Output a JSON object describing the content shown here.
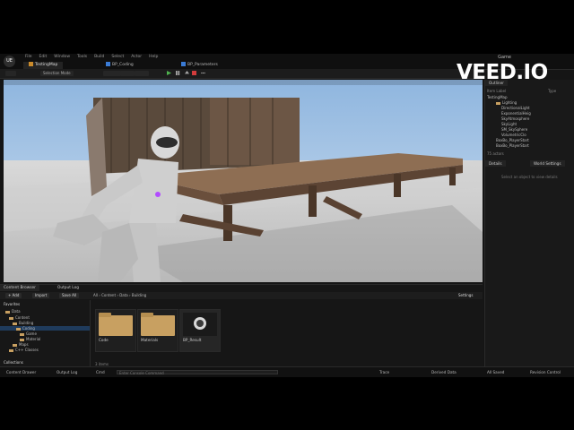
{
  "window": {
    "logo": "UE",
    "game_label": "Game",
    "menu": [
      "File",
      "Edit",
      "Window",
      "Tools",
      "Build",
      "Select",
      "Actor",
      "Help"
    ],
    "tabs": [
      {
        "label": "TestingMap"
      },
      {
        "label": "BP_Coding"
      },
      {
        "label": "BP_Parameters"
      }
    ]
  },
  "toolbar": {
    "mode": "Selection Mode"
  },
  "watermark": "VEED.IO",
  "outliner": {
    "tab": "Outliner",
    "header_label": "Item Label",
    "header_type": "Type",
    "rows": [
      {
        "label": "TestingMap",
        "type": "World"
      },
      {
        "label": "Lighting",
        "type": "Folder"
      },
      {
        "label": "DirectionalLight",
        "type": "DirectionalL"
      },
      {
        "label": "ExponentialHeig",
        "type": "ExponentialH"
      },
      {
        "label": "SkyAtmosphere",
        "type": "SkyAtmosph"
      },
      {
        "label": "SkyLight",
        "type": "SkyLight"
      },
      {
        "label": "SM_SkySphere",
        "type": "StaticMesh"
      },
      {
        "label": "VolumetricClo",
        "type": "VolumetricC"
      },
      {
        "label": "BoxBo_PlayerStart",
        "type": "Object Ref"
      },
      {
        "label": "BoxBo_PlayerStart",
        "type": "Object Ref"
      }
    ],
    "count": "75 actors"
  },
  "details": {
    "tab_details": "Details",
    "tab_world": "World Settings",
    "empty_text": "Select an object to view details"
  },
  "bottom": {
    "tab_content": "Content Browser",
    "tab_output": "Output Log",
    "add_label": "+ Add",
    "import_label": "Import",
    "save_all_label": "Save All",
    "breadcrumb": [
      "All",
      "Content",
      "Data",
      "Building"
    ],
    "settings_label": "Settings",
    "favorites": "Favorites",
    "tree": [
      {
        "label": "Data",
        "sel": false
      },
      {
        "label": "Content",
        "sel": false
      },
      {
        "label": "Building",
        "sel": false
      },
      {
        "label": "Coding",
        "sel": true
      },
      {
        "label": "Game",
        "sel": false
      },
      {
        "label": "Material",
        "sel": false
      },
      {
        "label": "Maps",
        "sel": false
      },
      {
        "label": "C++ Classes",
        "sel": false
      }
    ],
    "collections": "Collections",
    "items_count": "3 items",
    "assets": [
      {
        "name": "Code",
        "kind": "folder"
      },
      {
        "name": "Materials",
        "kind": "folder"
      },
      {
        "name": "BP_Result",
        "kind": "blueprint"
      }
    ]
  },
  "statusbar": {
    "content_drawer": "Content Drawer",
    "output_log": "Output Log",
    "cmd": "Cmd",
    "cmd_placeholder": "Enter Console Command",
    "trace": "Trace",
    "derived_data": "Derived Data",
    "unsaved": "All Saved",
    "revision": "Revision Control"
  },
  "colors": {
    "accent": "#2a5d8f",
    "selection": "#1f3b5c",
    "folder": "#c8a061"
  }
}
